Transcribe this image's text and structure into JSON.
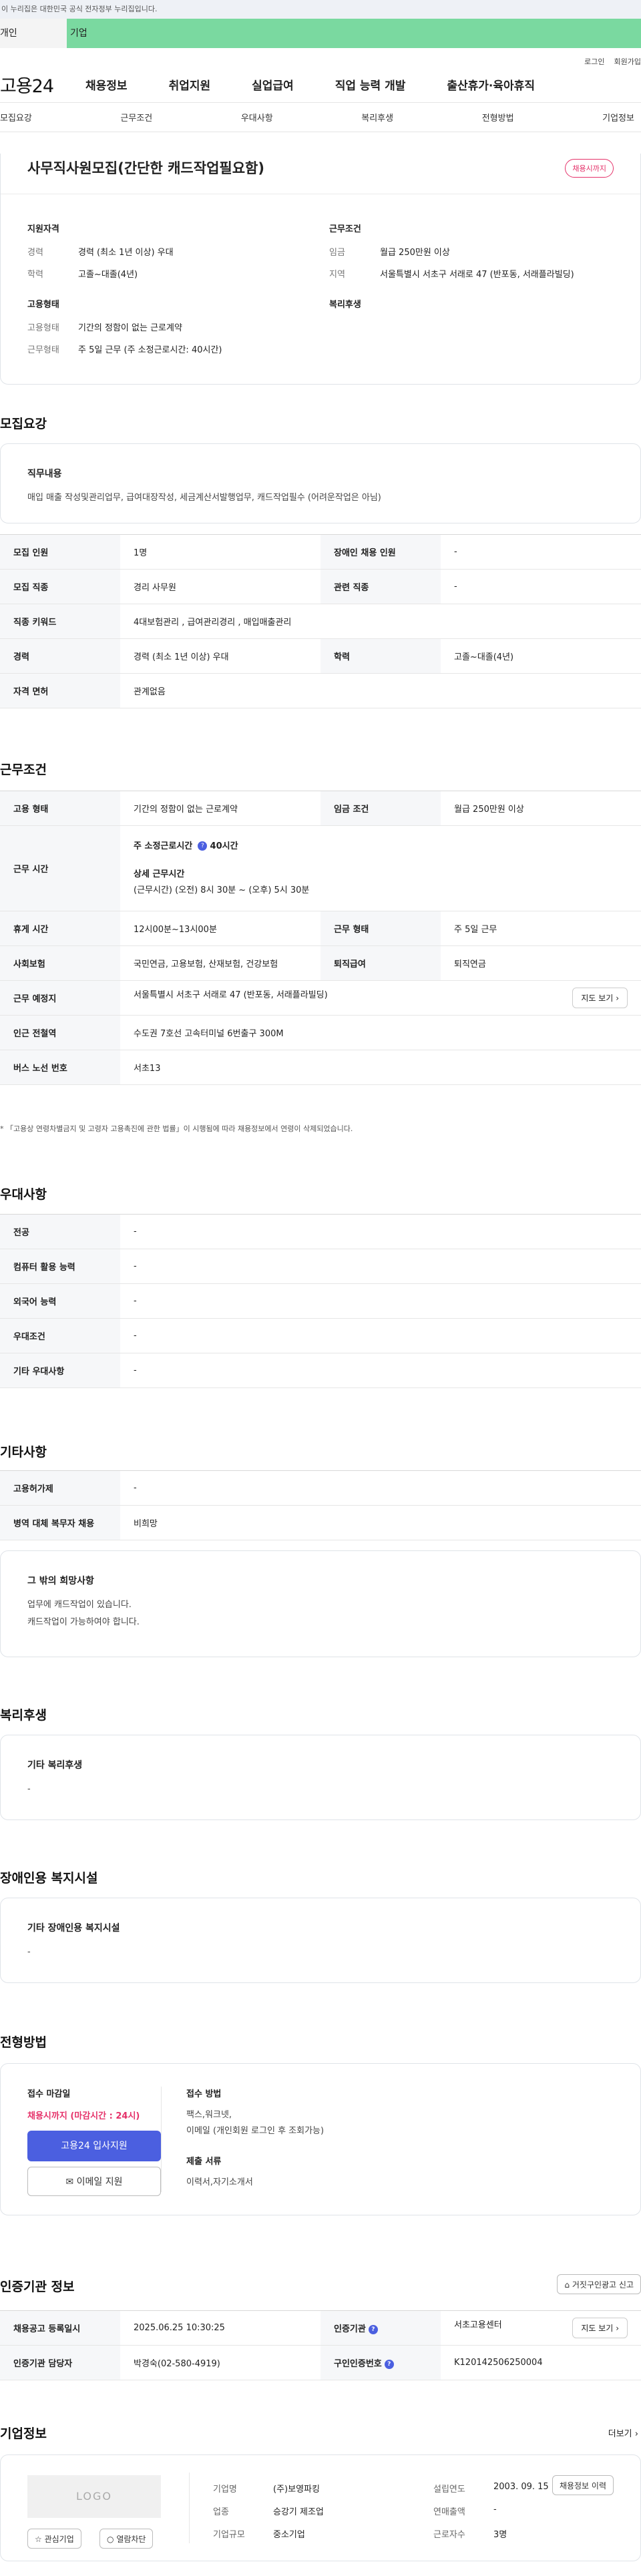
{
  "gov_banner": "이 누리집은 대한민국 공식 전자정부 누리집입니다.",
  "user_tabs": [
    "개인",
    "기업"
  ],
  "top_links": [
    "로그인",
    "회원가입"
  ],
  "logo": "고용24",
  "gnb": [
    "채용정보",
    "취업지원",
    "실업급여",
    "직업 능력 개발",
    "출산휴가·육아휴직"
  ],
  "subnav": [
    "모집요강",
    "근무조건",
    "우대사항",
    "복리후생",
    "전형방법",
    "기업정보"
  ],
  "job": {
    "title": "사무직사원모집(간단한 캐드작업필요함)",
    "badge": "채용시까지",
    "summary": {
      "qual_h": "지원자격",
      "qual": [
        [
          "경력",
          "경력 (최소 1년 이상) 우대"
        ],
        [
          "학력",
          "고졸~대졸(4년)"
        ]
      ],
      "work_h": "근무조건",
      "work": [
        [
          "임금",
          "월급 250만원 이상"
        ],
        [
          "지역",
          "서울특별시 서초구 서래로 47 (반포동, 서래플라빌딩)"
        ]
      ],
      "emp_h": "고용형태",
      "emp": [
        [
          "고용형태",
          "기간의 정함이 없는 근로계약"
        ],
        [
          "근무형태",
          "주 5일 근무 (주 소정근로시간: 40시간)"
        ]
      ],
      "welfare_h": "복리후생"
    }
  },
  "recruit": {
    "title": "모집요강",
    "duty_h": "직무내용",
    "duty": "매입 매출 작성및관리업무, 급여대장작성, 세금계산서발행업무, 캐드작업필수 (어려운작업은 아님)",
    "rows": [
      [
        "모집 인원",
        "1명",
        "장애인 채용 인원",
        "-"
      ],
      [
        "모집 직종",
        "경리 사무원",
        "관련 직종",
        "-"
      ],
      [
        "직종 키워드",
        "4대보험관리 , 급여관리경리 , 매입매출관리",
        "",
        ""
      ],
      [
        "경력",
        "경력 (최소 1년 이상) 우대",
        "학력",
        "고졸~대졸(4년)"
      ],
      [
        "자격 면허",
        "관계없음",
        "",
        ""
      ]
    ]
  },
  "conditions": {
    "title": "근무조건",
    "employment_k": "고용 형태",
    "employment_v": "기간의 정함이 없는 근로계약",
    "wage_k": "임금 조건",
    "wage_v": "월급 250만원 이상",
    "hours_k": "근무 시간",
    "weekly_label": "주 소정근로시간",
    "weekly_value": "40시간",
    "detail_label": "상세 근무시간",
    "detail_value": "(근무시간) (오전) 8시 30분 ~ (오후) 5시 30분",
    "break_k": "휴게 시간",
    "break_v": "12시00분~13시00분",
    "worktype_k": "근무 형태",
    "worktype_v": "주 5일 근무",
    "insurance_k": "사회보험",
    "insurance_v": "국민연금, 고용보험, 산재보험, 건강보험",
    "retire_k": "퇴직급여",
    "retire_v": "퇴직연금",
    "place_k": "근무 예정지",
    "place_v": "서울특별시 서초구 서래로 47 (반포동, 서래플라빌딩)",
    "map_btn": "지도 보기",
    "subway_k": "인근 전철역",
    "subway_v": "수도권 7호선 고속터미널 6번출구 300M",
    "bus_k": "버스 노선 번호",
    "bus_v": "서초13",
    "note": "* 「고용상 연령차별금지 및 고령자 고용촉진에 관한 법률」이 시행됨에 따라 채용정보에서 연령이 삭제되었습니다."
  },
  "preference": {
    "title": "우대사항",
    "rows": [
      [
        "전공",
        "-"
      ],
      [
        "컴퓨터 활용 능력",
        "-"
      ],
      [
        "외국어 능력",
        "-"
      ],
      [
        "우대조건",
        "-"
      ],
      [
        "기타 우대사항",
        "-"
      ]
    ]
  },
  "other": {
    "title": "기타사항",
    "rows": [
      [
        "고용허가제",
        "-"
      ],
      [
        "병역 대체 복무자 채용",
        "비희망"
      ]
    ],
    "hope_h": "그 밖의 희망사항",
    "hope_lines": [
      "업무에 캐드작업이 있습니다.",
      "캐드작업이 가능하여야 합니다."
    ]
  },
  "welfare": {
    "title": "복리후생",
    "h": "기타 복리후생",
    "v": "-"
  },
  "disabled": {
    "title": "장애인용 복지시설",
    "h": "기타 장애인용 복지시설",
    "v": "-"
  },
  "process": {
    "title": "전형방법",
    "deadline_h": "접수 마감일",
    "deadline_v": "채용시까지 (마감시간 : 24시)",
    "apply_btn": "고용24 입사지원",
    "email_btn": "이메일 지원",
    "method_h": "접수 방법",
    "method_lines": [
      "팩스,워크넷,",
      "이메일 (개인회원 로그인 후 조회가능)"
    ],
    "docs_h": "제출 서류",
    "docs_v": "이력서,자기소개서"
  },
  "agency": {
    "title": "인증기관 정보",
    "report_btn": "거짓구인광고 신고",
    "date_k": "채용공고 등록일시",
    "date_v": "2025.06.25 10:30:25",
    "agency_k": "인증기관",
    "agency_v": "서초고용센터",
    "map_btn": "지도 보기",
    "manager_k": "인증기관 담당자",
    "manager_v": "박경숙(02-580-4919)",
    "num_k": "구인인증번호",
    "num_v": "K120142506250004"
  },
  "company": {
    "title": "기업정보",
    "more": "더보기",
    "logo": "LOGO",
    "fav_btn": "관심기업",
    "block_btn": "열람차단",
    "history_btn": "채용정보 이력",
    "rows": [
      [
        "기업명",
        "(주)보영파킹",
        "설립연도",
        "2003. 09. 15"
      ],
      [
        "업종",
        "승강기 제조업",
        "연매출액",
        "-"
      ],
      [
        "기업규모",
        "중소기업",
        "근로자수",
        "3명"
      ]
    ]
  }
}
